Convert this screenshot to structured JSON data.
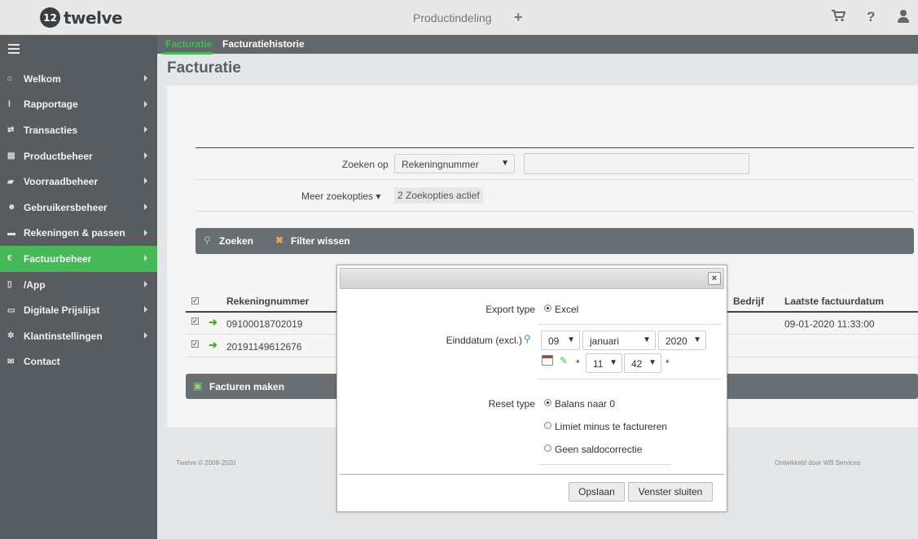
{
  "header": {
    "logo_mark": "12",
    "logo_text": "twelve",
    "title": "Productindeling",
    "add_label": "+",
    "icons": [
      "cart-icon",
      "help-icon",
      "user-icon"
    ]
  },
  "sidebar": {
    "items": [
      {
        "label": "Welkom",
        "icon": "home-icon",
        "glyph": "⌂"
      },
      {
        "label": "Rapportage",
        "icon": "chart-icon",
        "glyph": "⌇"
      },
      {
        "label": "Transacties",
        "icon": "exchange-icon",
        "glyph": "⇄"
      },
      {
        "label": "Productbeheer",
        "icon": "basket-icon",
        "glyph": "▤"
      },
      {
        "label": "Voorraadbeheer",
        "icon": "truck-icon",
        "glyph": "▰"
      },
      {
        "label": "Gebruikersbeheer",
        "icon": "users-icon",
        "glyph": "☻"
      },
      {
        "label": "Rekeningen & passen",
        "icon": "card-icon",
        "glyph": "▬"
      },
      {
        "label": "Factuurbeheer",
        "icon": "euro-icon",
        "glyph": "€"
      },
      {
        "label": "/App",
        "icon": "tablet-icon",
        "glyph": "▯"
      },
      {
        "label": "Digitale Prijslijst",
        "icon": "monitor-icon",
        "glyph": "▭"
      },
      {
        "label": "Klantinstellingen",
        "icon": "cogs-icon",
        "glyph": "✲"
      },
      {
        "label": "Contact",
        "icon": "envelope-icon",
        "glyph": "✉"
      }
    ],
    "active_index": 7
  },
  "tabs": [
    {
      "label": "Facturatie",
      "active": true
    },
    {
      "label": "Facturatiehistorie",
      "active": false
    }
  ],
  "page_title": "Facturatie",
  "search": {
    "label": "Zoeken op",
    "field_value": "Rekeningnummer",
    "input_value": "",
    "more_label": "Meer zoekopties ▾",
    "active_badge": "2 Zoekopties actief",
    "search_button": "Zoeken",
    "clear_button": "Filter wissen"
  },
  "table": {
    "columns": [
      "Rekeningnummer",
      "Bedrijf",
      "Laatste factuurdatum"
    ],
    "rows": [
      {
        "account": "09100018702019",
        "company": "",
        "last_invoice": "09-01-2020 11:33:00",
        "checked": true
      },
      {
        "account": "20191149612676",
        "company": "",
        "last_invoice": "",
        "checked": true
      }
    ]
  },
  "make_invoices_button": "Facturen maken",
  "footer": {
    "left": "Twelve © 2008-2020",
    "right": "Ontwikkeld door WB Services"
  },
  "modal": {
    "close_label": "×",
    "export_type_label": "Export type",
    "export_option": "Excel",
    "end_date_label": "Einddatum (excl.)",
    "day": "09",
    "month": "januari",
    "year": "2020",
    "hour": "11",
    "minute": "42",
    "required_mark": "*",
    "reset_type_label": "Reset type",
    "reset_options": [
      {
        "label": "Balans naar 0",
        "selected": true
      },
      {
        "label": "Limiet minus te factureren",
        "selected": false
      },
      {
        "label": "Geen saldocorrectie",
        "selected": false
      }
    ],
    "save_button": "Opslaan",
    "close_button": "Venster sluiten"
  }
}
